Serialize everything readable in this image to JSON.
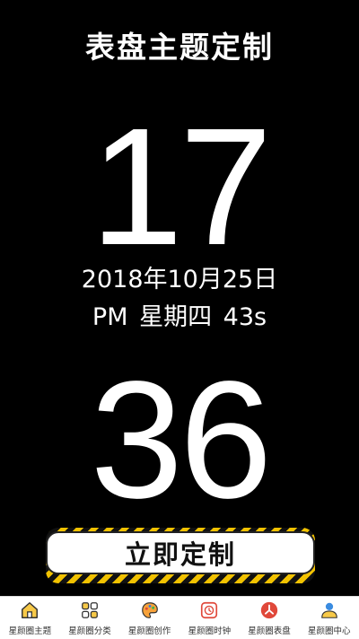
{
  "header": {
    "title": "表盘主题定制"
  },
  "clock": {
    "hour": "17",
    "date": "2018年10月25日",
    "weekline": "PM 星期四 43s",
    "minute": "36"
  },
  "cta": {
    "label": "立即定制"
  },
  "tabs": [
    {
      "label": "星颜圈主题",
      "icon": "home-icon"
    },
    {
      "label": "星颜圈分类",
      "icon": "grid-icon"
    },
    {
      "label": "星颜圈创作",
      "icon": "palette-icon"
    },
    {
      "label": "星颜圈时钟",
      "icon": "clock-icon"
    },
    {
      "label": "星颜圈表盘",
      "icon": "dial-icon"
    },
    {
      "label": "星颜圈中心",
      "icon": "user-icon"
    }
  ],
  "colors": {
    "accent": "#f2c200",
    "background": "#000000",
    "tab_red": "#e0483a"
  }
}
